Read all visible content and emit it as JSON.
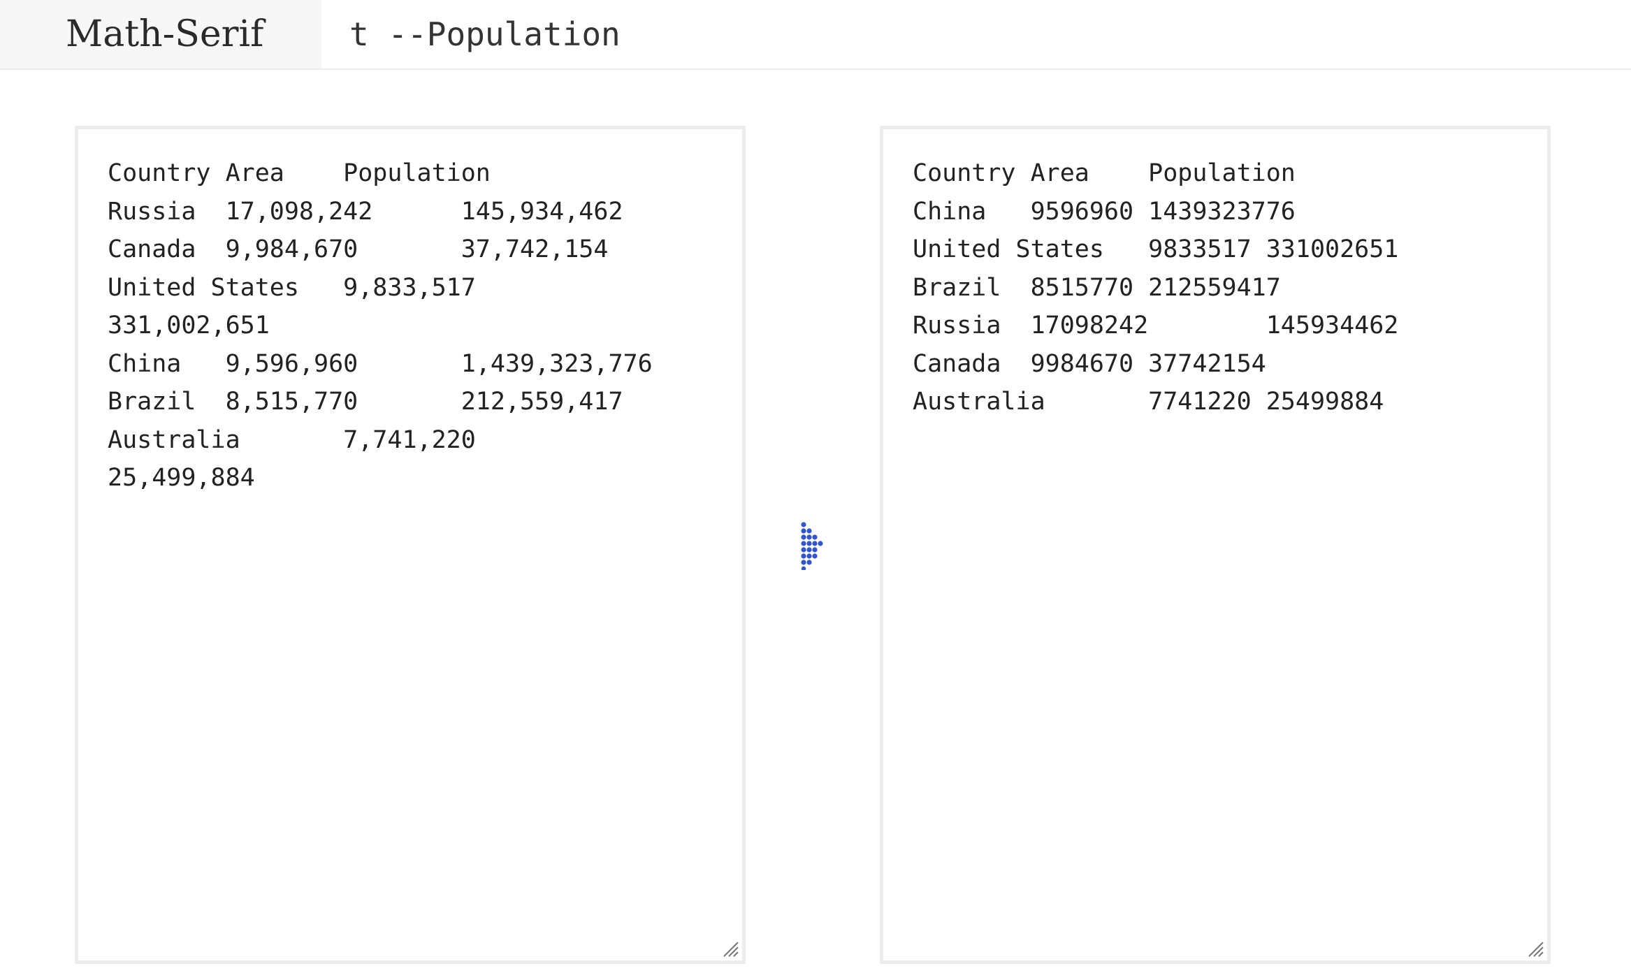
{
  "header": {
    "font_tab_label": "Math-Serif",
    "command_text": "t --Population"
  },
  "input_panel": {
    "text": "Country\tArea\tPopulation\nRussia\t17,098,242\t145,934,462\nCanada\t9,984,670\t37,742,154\nUnited States\t9,833,517\t331,002,651\nChina\t9,596,960\t1,439,323,776\nBrazil\t8,515,770\t212,559,417\nAustralia\t7,741,220\t25,499,884"
  },
  "output_panel": {
    "text": "Country\tArea\tPopulation\nChina\t9596960\t1439323776\nUnited States\t9833517\t331002651\nBrazil\t8515770\t212559417\nRussia\t17098242\t145934462\nCanada\t9984670\t37742154\nAustralia\t7741220\t25499884"
  },
  "convert_button": {
    "icon": "dotted-arrow-right-icon"
  },
  "colors": {
    "accent": "#3355cc",
    "border": "#ececec",
    "tab_background": "#f7f7f7",
    "text": "#222222"
  }
}
